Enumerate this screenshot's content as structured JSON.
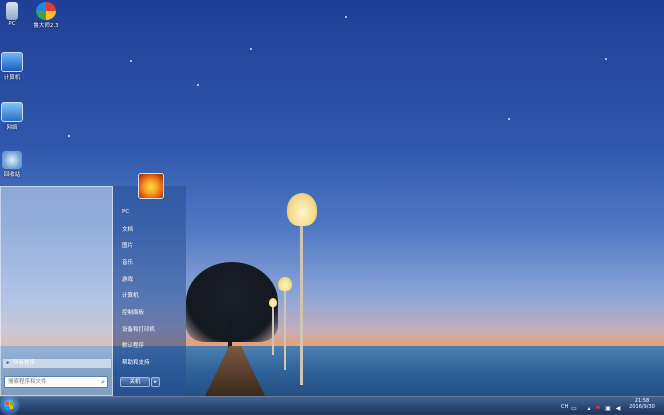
{
  "desktop": {
    "icons": [
      {
        "label": "PC"
      },
      {
        "label": "鲁大师2.3"
      },
      {
        "label": "计算机"
      },
      {
        "label": "网络"
      },
      {
        "label": "回收站"
      }
    ]
  },
  "start_menu": {
    "right_items": [
      {
        "label": "PC"
      },
      {
        "label": "文档"
      },
      {
        "label": "图片"
      },
      {
        "label": "音乐"
      },
      {
        "label": "游戏"
      },
      {
        "label": "计算机"
      },
      {
        "label": "控制面板"
      },
      {
        "label": "设备和打印机"
      },
      {
        "label": "默认程序"
      },
      {
        "label": "帮助和支持"
      }
    ],
    "all_programs_label": "所有程序",
    "search_placeholder": "搜索程序和文件",
    "shutdown_label": "关机"
  },
  "taskbar": {
    "language": "CH",
    "clock_time": "21:58",
    "clock_date": "2016/9/30"
  },
  "colors": {
    "accent": "#2e74c9",
    "taskbar": "#1f3a70"
  }
}
